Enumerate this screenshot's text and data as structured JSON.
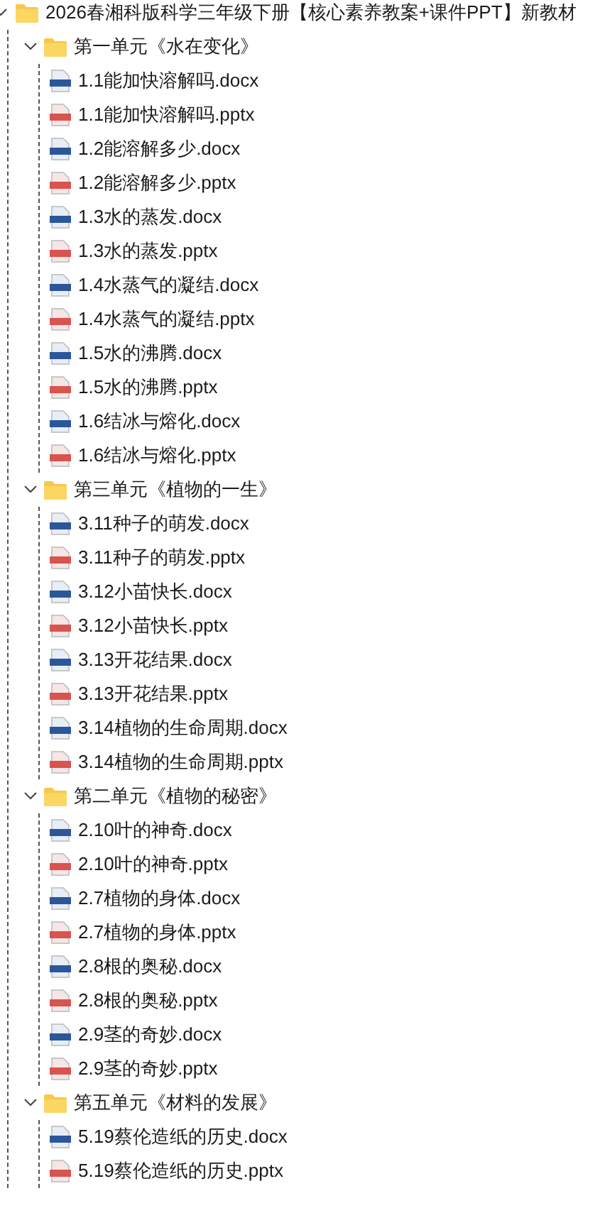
{
  "tree": {
    "name": "2026春湘科版科学三年级下册【核心素养教案+课件PPT】新教材",
    "expanded": true,
    "children": [
      {
        "name": "第一单元《水在变化》",
        "expanded": true,
        "children": [
          {
            "name": "1.1能加快溶解吗.docx",
            "kind": "docx"
          },
          {
            "name": "1.1能加快溶解吗.pptx",
            "kind": "pptx"
          },
          {
            "name": "1.2能溶解多少.docx",
            "kind": "docx"
          },
          {
            "name": "1.2能溶解多少.pptx",
            "kind": "pptx"
          },
          {
            "name": "1.3水的蒸发.docx",
            "kind": "docx"
          },
          {
            "name": "1.3水的蒸发.pptx",
            "kind": "pptx"
          },
          {
            "name": "1.4水蒸气的凝结.docx",
            "kind": "docx"
          },
          {
            "name": "1.4水蒸气的凝结.pptx",
            "kind": "pptx"
          },
          {
            "name": "1.5水的沸腾.docx",
            "kind": "docx"
          },
          {
            "name": "1.5水的沸腾.pptx",
            "kind": "pptx"
          },
          {
            "name": "1.6结冰与熔化.docx",
            "kind": "docx"
          },
          {
            "name": "1.6结冰与熔化.pptx",
            "kind": "pptx"
          }
        ]
      },
      {
        "name": "第三单元《植物的一生》",
        "expanded": true,
        "children": [
          {
            "name": "3.11种子的萌发.docx",
            "kind": "docx"
          },
          {
            "name": "3.11种子的萌发.pptx",
            "kind": "pptx"
          },
          {
            "name": "3.12小苗快长.docx",
            "kind": "docx"
          },
          {
            "name": "3.12小苗快长.pptx",
            "kind": "pptx"
          },
          {
            "name": "3.13开花结果.docx",
            "kind": "docx"
          },
          {
            "name": "3.13开花结果.pptx",
            "kind": "pptx"
          },
          {
            "name": "3.14植物的生命周期.docx",
            "kind": "docx"
          },
          {
            "name": "3.14植物的生命周期.pptx",
            "kind": "pptx"
          }
        ]
      },
      {
        "name": "第二单元《植物的秘密》",
        "expanded": true,
        "children": [
          {
            "name": "2.10叶的神奇.docx",
            "kind": "docx"
          },
          {
            "name": "2.10叶的神奇.pptx",
            "kind": "pptx"
          },
          {
            "name": "2.7植物的身体.docx",
            "kind": "docx"
          },
          {
            "name": "2.7植物的身体.pptx",
            "kind": "pptx"
          },
          {
            "name": "2.8根的奥秘.docx",
            "kind": "docx"
          },
          {
            "name": "2.8根的奥秘.pptx",
            "kind": "pptx"
          },
          {
            "name": "2.9茎的奇妙.docx",
            "kind": "docx"
          },
          {
            "name": "2.9茎的奇妙.pptx",
            "kind": "pptx"
          }
        ]
      },
      {
        "name": "第五单元《材料的发展》",
        "expanded": true,
        "children": [
          {
            "name": "5.19蔡伦造纸的历史.docx",
            "kind": "docx"
          },
          {
            "name": "5.19蔡伦造纸的历史.pptx",
            "kind": "pptx"
          }
        ]
      }
    ]
  }
}
